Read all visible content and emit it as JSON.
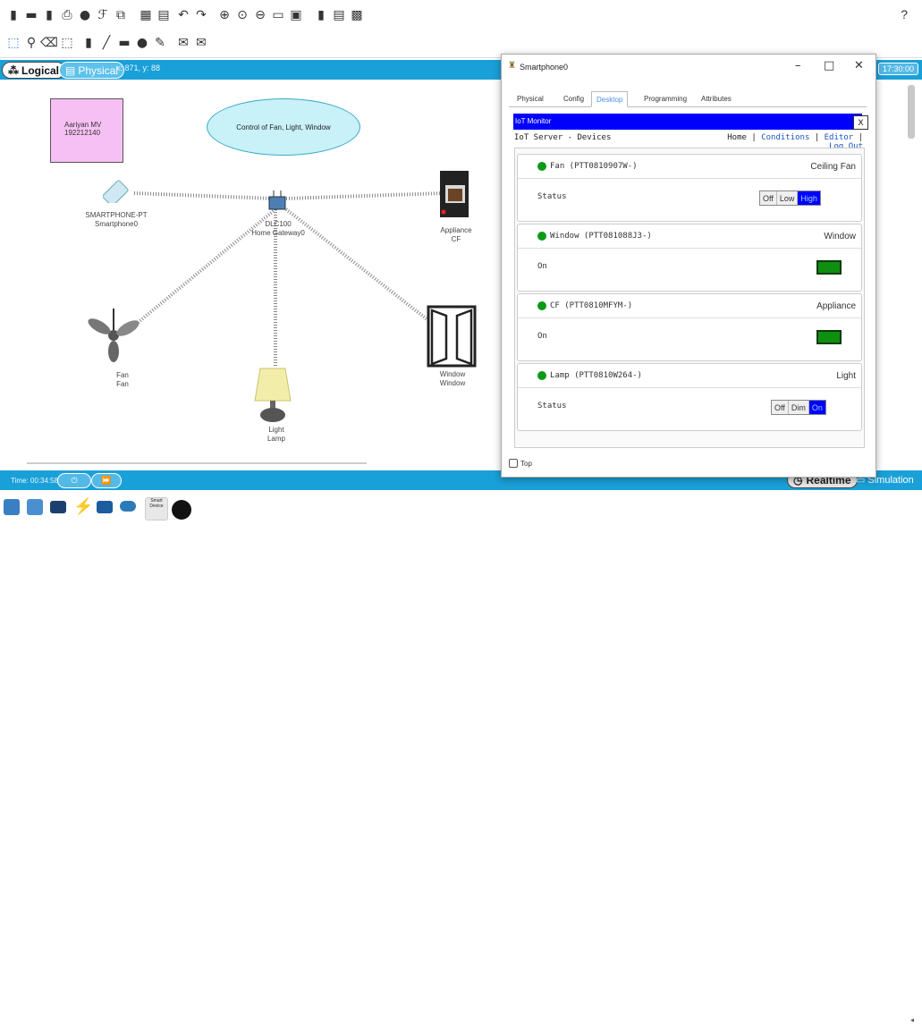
{
  "toolbar": {
    "help": "?",
    "icons_row1": [
      "new-icon",
      "open-icon",
      "save-icon",
      "print-icon",
      "wizard-icon",
      "network-info-icon",
      "copy-icon",
      "paste-icon",
      "undo-icon",
      "redo-icon",
      "zoom-in-icon",
      "zoom-reset-icon",
      "zoom-out-icon",
      "drawing-palette-icon",
      "custom-device-icon",
      "viewport-icon",
      "pdu-list-icon",
      "image-icon"
    ],
    "icons_row2": [
      "select-icon",
      "inspect-icon",
      "delete-icon",
      "resize-icon",
      "note-icon",
      "line-icon",
      "rectangle-icon",
      "ellipse-icon",
      "freeform-icon",
      "simple-pdu-icon",
      "complex-pdu-icon"
    ]
  },
  "workspace": {
    "tab_logical": "Logical",
    "tab_physical": "Physical",
    "coords": "x: 871, y: 88",
    "clock": "17:30:00"
  },
  "canvas": {
    "name_box": {
      "line1": "Aariyan MV",
      "line2": "192212140"
    },
    "title": "Control of Fan, Light, Window",
    "devices": {
      "smartphone": {
        "model": "SMARTPHONE-PT",
        "name": "Smartphone0"
      },
      "gateway": {
        "model": "DLC100",
        "name": "Home Gateway0"
      },
      "appliance": {
        "model": "Appliance",
        "name": "CF"
      },
      "fan": {
        "model": "Fan",
        "name": "Fan"
      },
      "lamp": {
        "model": "Light",
        "name": "Lamp"
      },
      "window": {
        "model": "Window",
        "name": "Window"
      }
    }
  },
  "bottom": {
    "time": "Time: 00:34:58",
    "realtime": "Realtime",
    "simulation": "Simulation"
  },
  "palette": {
    "smart_device_label": "Smart Device"
  },
  "dialog": {
    "title": "Smartphone0",
    "minimize": "–",
    "maximize": "□",
    "close": "✕",
    "tabs": [
      "Physical",
      "Config",
      "Desktop",
      "Programming",
      "Attributes"
    ],
    "active_tab": "Desktop",
    "iot_header": "IoT Monitor",
    "iot_close": "X",
    "server_title": "IoT Server - Devices",
    "nav": {
      "home": "Home",
      "conditions": "Conditions",
      "editor": "Editor",
      "logout": "Log Out",
      "sep": " | "
    },
    "devices": [
      {
        "name": "Fan (PTT0810907W-)",
        "type": "Ceiling Fan",
        "prop": "Status",
        "options": [
          "Off",
          "Low",
          "High"
        ],
        "selected": "High",
        "status_color": "#0a9a18"
      },
      {
        "name": "Window (PTT081088J3-)",
        "type": "Window",
        "prop": "On",
        "indicator": "on",
        "status_color": "#0a9a18"
      },
      {
        "name": "CF (PTT0810MFYM-)",
        "type": "Appliance",
        "prop": "On",
        "indicator": "on",
        "status_color": "#0a9a18"
      },
      {
        "name": "Lamp (PTT0810W264-)",
        "type": "Light",
        "prop": "Status",
        "options": [
          "Off",
          "Dim",
          "On"
        ],
        "selected": "On",
        "status_color": "#0a9a18"
      }
    ],
    "top_checkbox": "Top"
  }
}
